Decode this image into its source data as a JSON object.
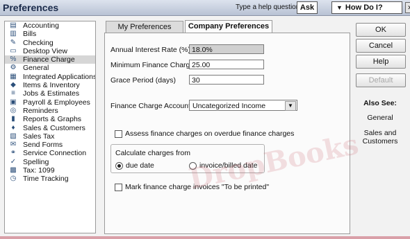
{
  "window": {
    "title": "Preferences",
    "help_prompt": "Type a help question",
    "ask_label": "Ask",
    "how_do_i_label": "How Do I?"
  },
  "sidebar": {
    "items": [
      {
        "label": "Accounting",
        "icon": "ledger-icon"
      },
      {
        "label": "Bills",
        "icon": "bills-icon"
      },
      {
        "label": "Checking",
        "icon": "checkbook-icon"
      },
      {
        "label": "Desktop View",
        "icon": "desktop-icon"
      },
      {
        "label": "Finance Charge",
        "icon": "finance-charge-icon",
        "selected": true
      },
      {
        "label": "General",
        "icon": "general-icon"
      },
      {
        "label": "Integrated Applications",
        "icon": "integrated-apps-icon"
      },
      {
        "label": "Items & Inventory",
        "icon": "inventory-icon"
      },
      {
        "label": "Jobs & Estimates",
        "icon": "jobs-icon"
      },
      {
        "label": "Payroll & Employees",
        "icon": "payroll-icon"
      },
      {
        "label": "Reminders",
        "icon": "reminders-icon"
      },
      {
        "label": "Reports & Graphs",
        "icon": "reports-icon"
      },
      {
        "label": "Sales & Customers",
        "icon": "sales-icon"
      },
      {
        "label": "Sales Tax",
        "icon": "sales-tax-icon"
      },
      {
        "label": "Send Forms",
        "icon": "send-forms-icon"
      },
      {
        "label": "Service Connection",
        "icon": "service-connection-icon"
      },
      {
        "label": "Spelling",
        "icon": "spelling-icon"
      },
      {
        "label": "Tax: 1099",
        "icon": "tax-1099-icon"
      },
      {
        "label": "Time Tracking",
        "icon": "time-tracking-icon"
      }
    ]
  },
  "tabs": {
    "my_preferences": "My Preferences",
    "company_preferences": "Company Preferences"
  },
  "form": {
    "annual_rate_label": "Annual Interest Rate (%)",
    "annual_rate_value": "18.0%",
    "min_charge_label": "Minimum Finance Charge",
    "min_charge_value": "25.00",
    "grace_label": "Grace Period (days)",
    "grace_value": "30",
    "account_label": "Finance Charge Account",
    "account_value": "Uncategorized Income",
    "assess_label": "Assess finance charges on overdue finance charges",
    "calc_group_label": "Calculate charges from",
    "due_date_label": "due date",
    "invoice_date_label": "invoice/billed date",
    "mark_label": "Mark finance charge invoices \"To be printed\""
  },
  "buttons": {
    "ok": "OK",
    "cancel": "Cancel",
    "help": "Help",
    "default": "Default"
  },
  "also_see": {
    "heading": "Also See:",
    "general": "General",
    "sales_customers": "Sales and Customers"
  },
  "watermark": "DropBooks",
  "colors": {
    "titlebar": "#b8c2d4",
    "selected_row": "#d6d6d6",
    "watermark": "#c85a64"
  }
}
